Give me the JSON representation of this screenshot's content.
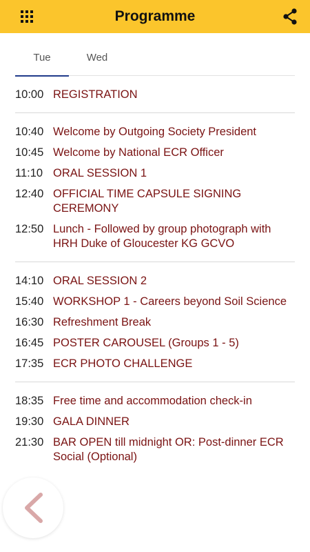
{
  "header": {
    "title": "Programme",
    "menu_icon": "grid-icon",
    "share_icon": "share-icon",
    "accent_color": "#fbc52c"
  },
  "tabs": [
    {
      "label": "Tue",
      "active": true
    },
    {
      "label": "Wed",
      "active": false
    }
  ],
  "schedule": [
    {
      "items": [
        {
          "time": "10:00",
          "event": "REGISTRATION"
        }
      ]
    },
    {
      "items": [
        {
          "time": "10:40",
          "event": "Welcome by Outgoing Society President"
        },
        {
          "time": "10:45",
          "event": "Welcome by National ECR Officer"
        },
        {
          "time": "11:10",
          "event": "ORAL SESSION 1"
        },
        {
          "time": "12:40",
          "event": "OFFICIAL TIME CAPSULE SIGNING CEREMONY"
        },
        {
          "time": "12:50",
          "event": "Lunch - Followed by group photograph with HRH Duke of Gloucester KG GCVO"
        }
      ]
    },
    {
      "items": [
        {
          "time": "14:10",
          "event": "ORAL SESSION 2"
        },
        {
          "time": "15:40",
          "event": "WORKSHOP 1 - Careers beyond Soil Science"
        },
        {
          "time": "16:30",
          "event": "Refreshment Break"
        },
        {
          "time": "16:45",
          "event": "POSTER CAROUSEL (Groups 1 - 5)"
        },
        {
          "time": "17:35",
          "event": "ECR PHOTO CHALLENGE"
        }
      ]
    },
    {
      "items": [
        {
          "time": "18:35",
          "event": "Free time and accommodation check-in"
        },
        {
          "time": "19:30",
          "event": "GALA DINNER"
        },
        {
          "time": "21:30",
          "event": "BAR OPEN till midnight OR: Post-dinner ECR Social (Optional)"
        }
      ]
    }
  ],
  "footer": {
    "back_icon": "chevron-left-icon"
  }
}
